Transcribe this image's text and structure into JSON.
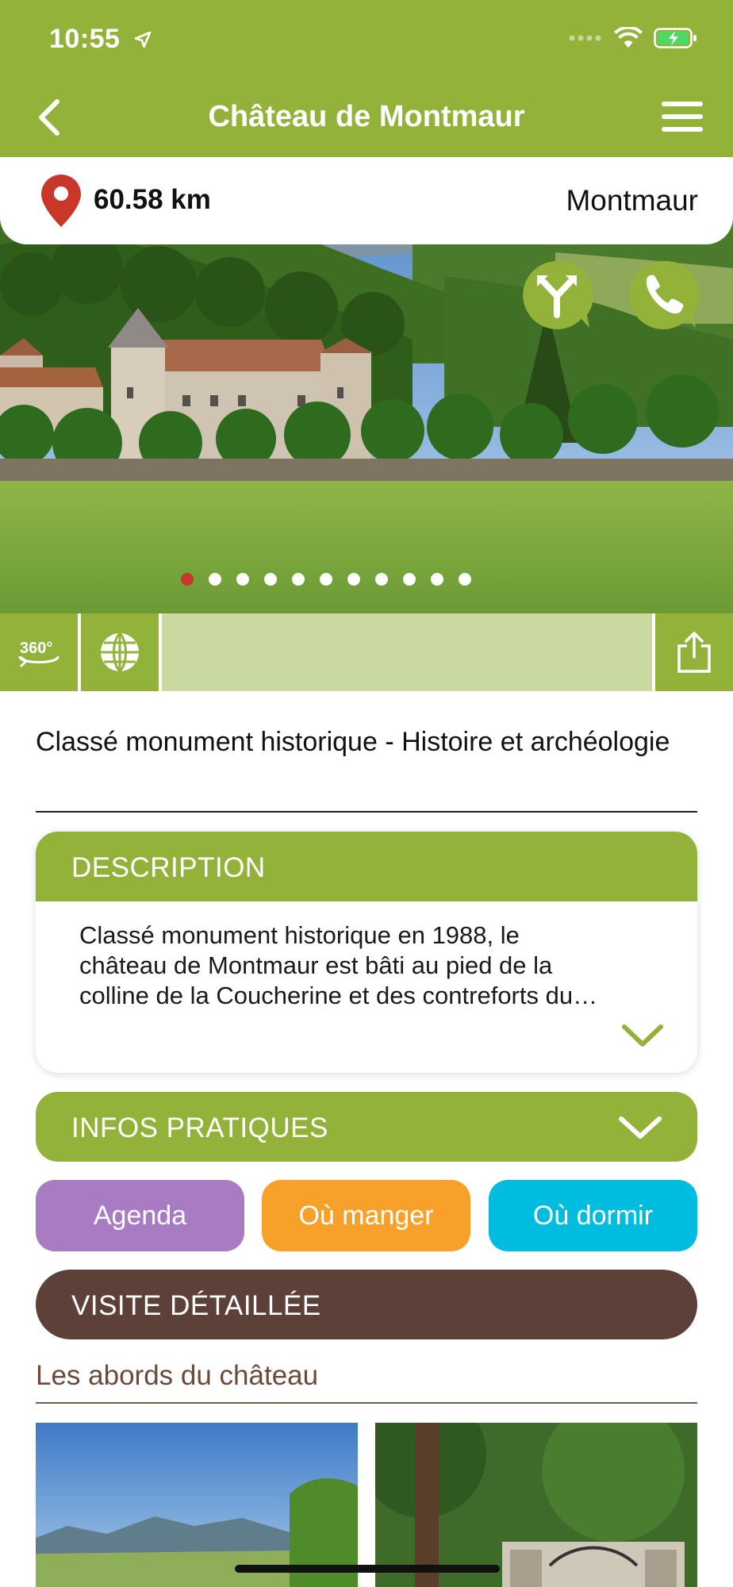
{
  "status_bar": {
    "time": "10:55"
  },
  "nav": {
    "title": "Château de Montmaur"
  },
  "location": {
    "distance": "60.58 km",
    "city": "Montmaur"
  },
  "carousel": {
    "total_slides": 11,
    "active_index": 0
  },
  "toolbar": {
    "view360_label": "360°"
  },
  "subtitle": "Classé monument historique - Histoire et archéologie",
  "description": {
    "header": "DESCRIPTION",
    "text": "Classé monument historique en 1988, le\nchâteau de Montmaur est bâti au pied de la\ncolline de la Coucherine et des contreforts du…"
  },
  "infos_pratiques": {
    "header": "INFOS PRATIQUES"
  },
  "quick_links": {
    "agenda": "Agenda",
    "manger": "Où manger",
    "dormir": "Où dormir"
  },
  "visite": {
    "header": "VISITE DÉTAILLÉE"
  },
  "section": {
    "title": "Les abords du château"
  },
  "colors": {
    "brand_green": "#93b23a",
    "light_green": "#c9d9a0",
    "agenda_purple": "#a97bc2",
    "manger_orange": "#f7a12a",
    "dormir_cyan": "#00bde0",
    "visite_brown": "#5d4037",
    "pin_red": "#c8372a"
  },
  "icons": [
    "location-arrow-icon",
    "wifi-icon",
    "battery-charging-icon",
    "back-chevron-icon",
    "hamburger-menu-icon",
    "map-pin-icon",
    "directions-icon",
    "phone-icon",
    "view-360-icon",
    "globe-icon",
    "share-icon",
    "chevron-down-icon"
  ]
}
